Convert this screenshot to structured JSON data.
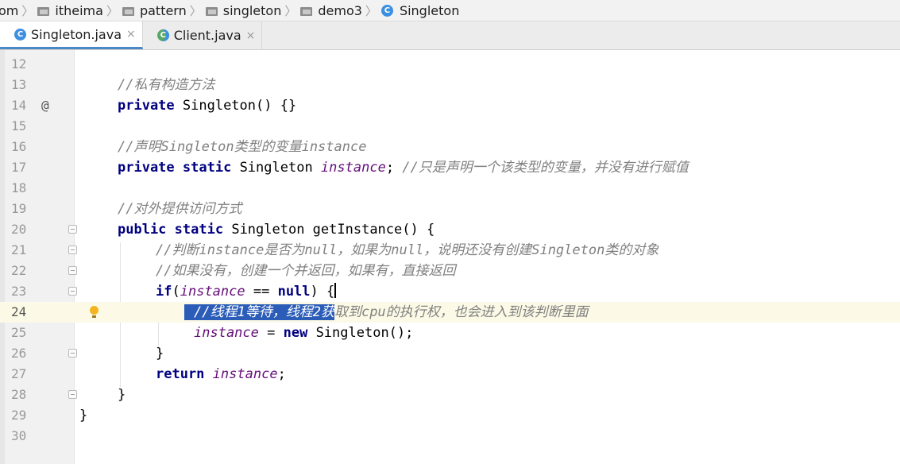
{
  "breadcrumb": {
    "items": [
      {
        "label": "om",
        "icon": "none"
      },
      {
        "label": "itheima",
        "icon": "folder-icon"
      },
      {
        "label": "pattern",
        "icon": "folder-icon"
      },
      {
        "label": "singleton",
        "icon": "folder-icon"
      },
      {
        "label": "demo3",
        "icon": "folder-icon"
      },
      {
        "label": "Singleton",
        "icon": "class-icon"
      }
    ],
    "separator": "〉"
  },
  "tabs": [
    {
      "label": "Singleton.java",
      "active": true,
      "icon": "class-icon",
      "close": "×"
    },
    {
      "label": "Client.java",
      "active": false,
      "icon": "runnable-class-icon",
      "close": "×"
    }
  ],
  "icons": {
    "class_letter": "C",
    "override": "@"
  },
  "editor": {
    "current_line": 24,
    "lines": [
      {
        "n": "12"
      },
      {
        "n": "13",
        "c": "//私有构造方法"
      },
      {
        "n": "14",
        "kw1": "private",
        "t1": " Singleton() {}"
      },
      {
        "n": "15"
      },
      {
        "n": "16",
        "c": "//声明Singleton类型的变量instance"
      },
      {
        "n": "17",
        "kw1": "private",
        "kw2": "static",
        "t1": " Singleton ",
        "f1": "instance",
        "t2": "; ",
        "c": "//只是声明一个该类型的变量，并没有进行赋值"
      },
      {
        "n": "18"
      },
      {
        "n": "19",
        "c": "//对外提供访问方式"
      },
      {
        "n": "20",
        "kw1": "public",
        "kw2": "static",
        "t1": " Singleton getInstance() {"
      },
      {
        "n": "21",
        "c": "//判断instance是否为null，如果为null，说明还没有创建Singleton类的对象"
      },
      {
        "n": "22",
        "c": "//如果没有，创建一个并返回，如果有，直接返回"
      },
      {
        "n": "23",
        "kw1": "if",
        "t1": "(",
        "f1": "instance",
        "t2": " == ",
        "kw2": "null",
        "t3": ") {"
      },
      {
        "n": "24",
        "sel": "//线程1等待，线程2获",
        "c": "取到cpu的执行权，也会进入到该判断里面"
      },
      {
        "n": "25",
        "f1": "instance",
        "t1": " = ",
        "kw1": "new",
        "t2": " Singleton();"
      },
      {
        "n": "26",
        "t1": "}"
      },
      {
        "n": "27",
        "kw1": "return",
        "f1": "instance",
        "t1": ";"
      },
      {
        "n": "28",
        "t1": "}"
      },
      {
        "n": "29",
        "t1": "}"
      },
      {
        "n": "30"
      }
    ]
  },
  "colors": {
    "keyword": "#000080",
    "comment": "#808080",
    "field": "#660e7a",
    "selection": "#2a5cb8",
    "current_line": "#fcfae6",
    "tab_underline": "#4a88c7"
  }
}
